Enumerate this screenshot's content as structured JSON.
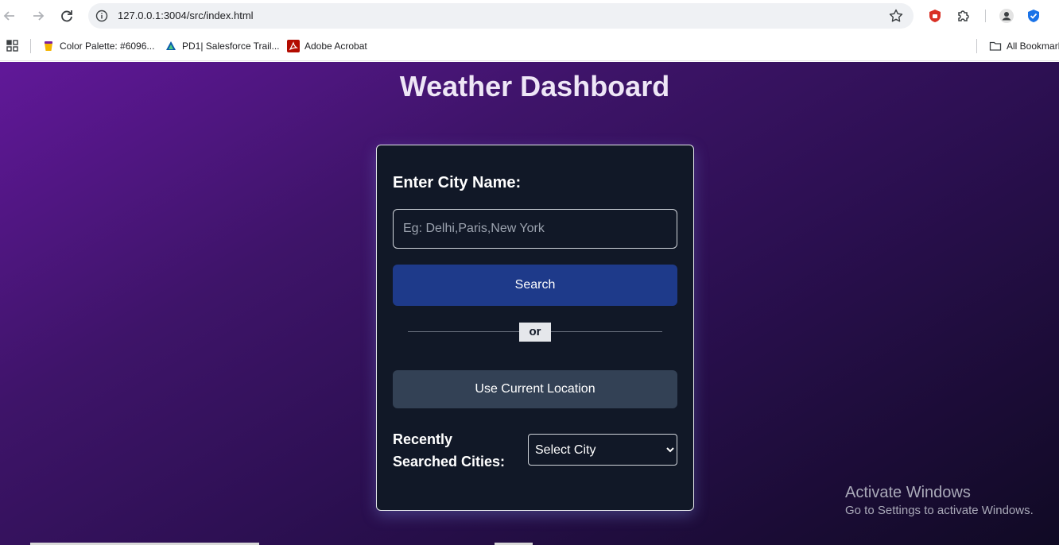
{
  "browser": {
    "url": "127.0.0.1:3004/src/index.html",
    "bookmarks": [
      {
        "label": "Color Palette: #6096...",
        "icon": "palette-favicon"
      },
      {
        "label": "PD1| Salesforce Trail...",
        "icon": "trailhead-favicon"
      },
      {
        "label": "Adobe Acrobat",
        "icon": "acrobat-favicon"
      }
    ],
    "all_bookmarks_label": "All Bookmarks"
  },
  "page": {
    "title": "Weather Dashboard",
    "city_label": "Enter City Name:",
    "city_input": {
      "placeholder": "Eg: Delhi,Paris,New York",
      "value": ""
    },
    "search_label": "Search",
    "or_label": "or",
    "location_label": "Use Current Location",
    "recent_label": "Recently Searched Cities:",
    "recent_select": {
      "selected": "Select City",
      "options": [
        "Select City"
      ]
    }
  },
  "os_watermark": {
    "title": "Activate Windows",
    "subtitle": "Go to Settings to activate Windows."
  },
  "colors": {
    "page_gradient_start": "#611899",
    "page_gradient_end": "#100a24",
    "card_bg": "#111827",
    "search_button": "#1e3a8a",
    "location_button": "#334155"
  }
}
